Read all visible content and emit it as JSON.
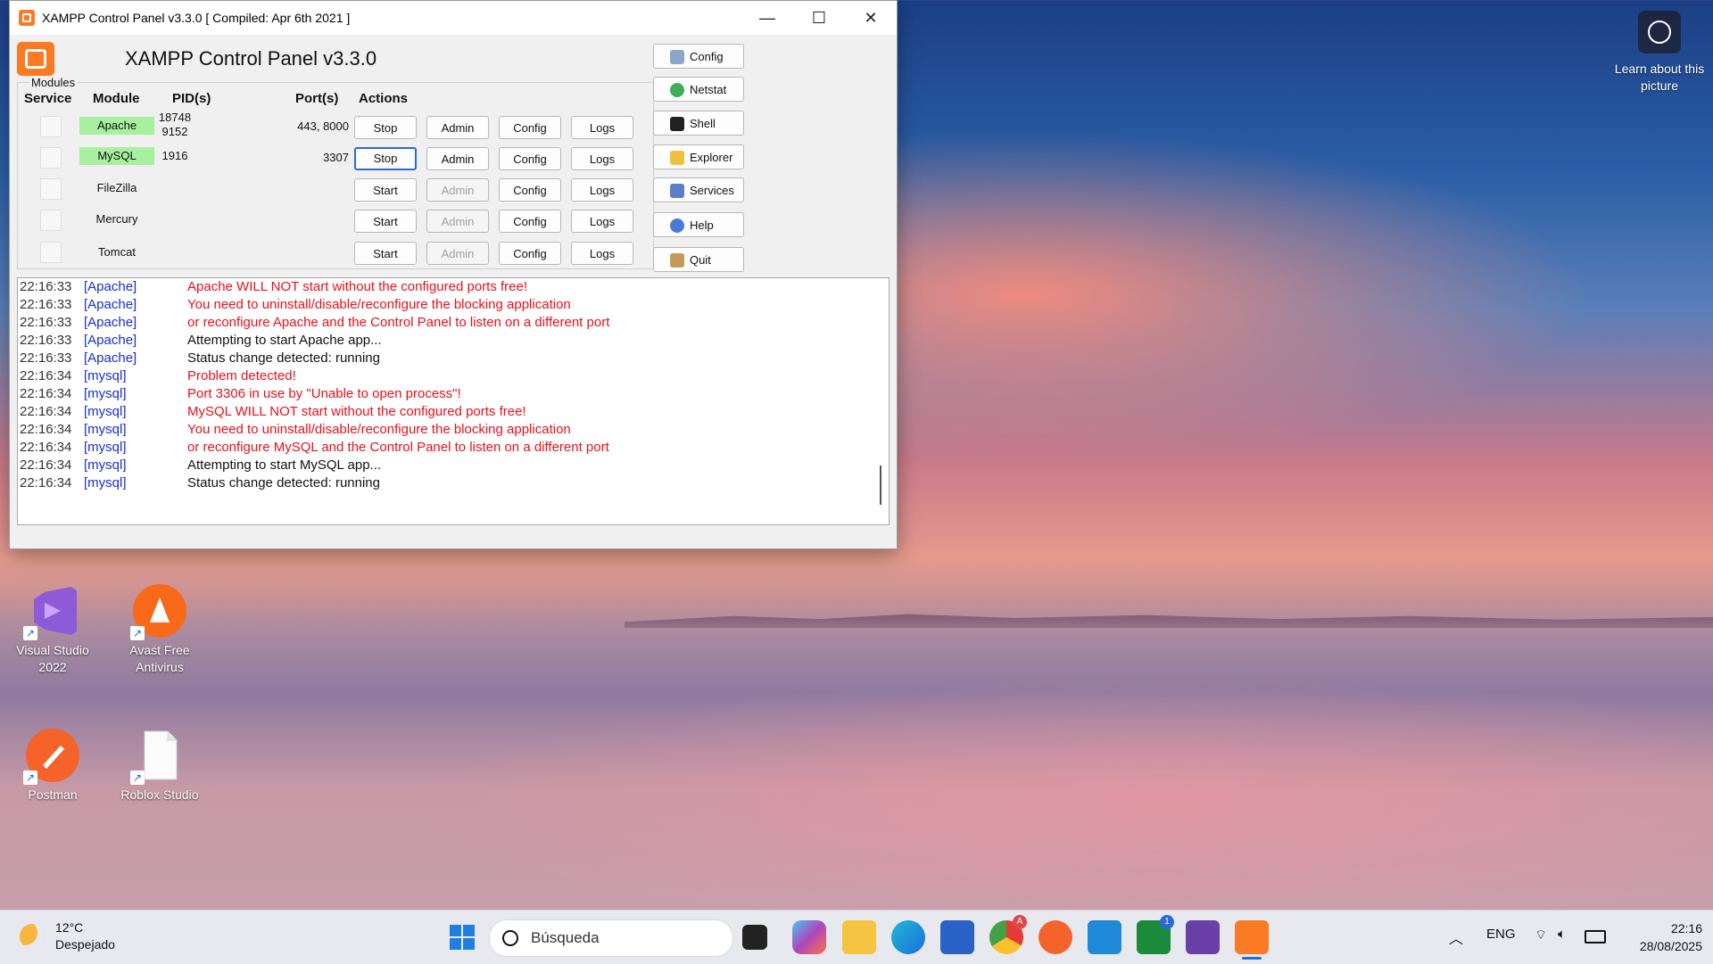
{
  "window": {
    "title": "XAMPP Control Panel v3.3.0   [ Compiled: Apr 6th 2021 ]",
    "app_title": "XAMPP Control Panel v3.3.0",
    "controls": {
      "minimize": "—",
      "maximize": "☐",
      "close": "✕"
    }
  },
  "modules_panel": {
    "group_label": "Modules",
    "headers": {
      "service": "Service",
      "module": "Module",
      "pid": "PID(s)",
      "port": "Port(s)",
      "actions": "Actions"
    },
    "rows": [
      {
        "module": "Apache",
        "running": true,
        "pid1": "18748",
        "pid2": "9152",
        "ports": "443, 8000",
        "action": "Stop",
        "admin": "Admin",
        "config": "Config",
        "logs": "Logs"
      },
      {
        "module": "MySQL",
        "running": true,
        "pid1": "1916",
        "pid2": "",
        "ports": "3307",
        "action": "Stop",
        "admin": "Admin",
        "config": "Config",
        "logs": "Logs"
      },
      {
        "module": "FileZilla",
        "running": false,
        "pid1": "",
        "pid2": "",
        "ports": "",
        "action": "Start",
        "admin": "Admin",
        "config": "Config",
        "logs": "Logs"
      },
      {
        "module": "Mercury",
        "running": false,
        "pid1": "",
        "pid2": "",
        "ports": "",
        "action": "Start",
        "admin": "Admin",
        "config": "Config",
        "logs": "Logs"
      },
      {
        "module": "Tomcat",
        "running": false,
        "pid1": "",
        "pid2": "",
        "ports": "",
        "action": "Start",
        "admin": "Admin",
        "config": "Config",
        "logs": "Logs"
      }
    ]
  },
  "side_buttons": {
    "config": "Config",
    "netstat": "Netstat",
    "shell": "Shell",
    "explorer": "Explorer",
    "services": "Services",
    "help": "Help",
    "quit": "Quit"
  },
  "log": [
    {
      "time": "22:16:33",
      "module": "[Apache]",
      "msg": "Apache WILL NOT start without the configured ports free!",
      "color": "red"
    },
    {
      "time": "22:16:33",
      "module": "[Apache]",
      "msg": "You need to uninstall/disable/reconfigure the blocking application",
      "color": "red"
    },
    {
      "time": "22:16:33",
      "module": "[Apache]",
      "msg": "or reconfigure Apache and the Control Panel to listen on a different port",
      "color": "red"
    },
    {
      "time": "22:16:33",
      "module": "[Apache]",
      "msg": "Attempting to start Apache app...",
      "color": "black"
    },
    {
      "time": "22:16:33",
      "module": "[Apache]",
      "msg": "Status change detected: running",
      "color": "black"
    },
    {
      "time": "22:16:34",
      "module": "[mysql]",
      "msg": "Problem detected!",
      "color": "red"
    },
    {
      "time": "22:16:34",
      "module": "[mysql]",
      "msg": "Port 3306 in use by \"Unable to open process\"!",
      "color": "red"
    },
    {
      "time": "22:16:34",
      "module": "[mysql]",
      "msg": "MySQL WILL NOT start without the configured ports free!",
      "color": "red"
    },
    {
      "time": "22:16:34",
      "module": "[mysql]",
      "msg": "You need to uninstall/disable/reconfigure the blocking application",
      "color": "red"
    },
    {
      "time": "22:16:34",
      "module": "[mysql]",
      "msg": "or reconfigure MySQL and the Control Panel to listen on a different port",
      "color": "red"
    },
    {
      "time": "22:16:34",
      "module": "[mysql]",
      "msg": "Attempting to start MySQL app...",
      "color": "black"
    },
    {
      "time": "22:16:34",
      "module": "[mysql]",
      "msg": "Status change detected: running",
      "color": "black"
    }
  ],
  "desktop": {
    "learn_about": "Learn about this picture",
    "icons": [
      {
        "label": "Visual Studio 2022",
        "icon": "visual-studio-icon"
      },
      {
        "label": "Avast Free Antivirus",
        "icon": "avast-icon"
      },
      {
        "label": "Postman",
        "icon": "postman-icon"
      },
      {
        "label": "Roblox Studio",
        "icon": "file-icon"
      }
    ]
  },
  "taskbar": {
    "temperature": "12°C",
    "weather": "Despejado",
    "search_placeholder": "Búsqueda",
    "language": "ENG",
    "time": "22:16",
    "date": "28/08/2025",
    "chrome_badge": "A",
    "xbox_badge": "1"
  }
}
